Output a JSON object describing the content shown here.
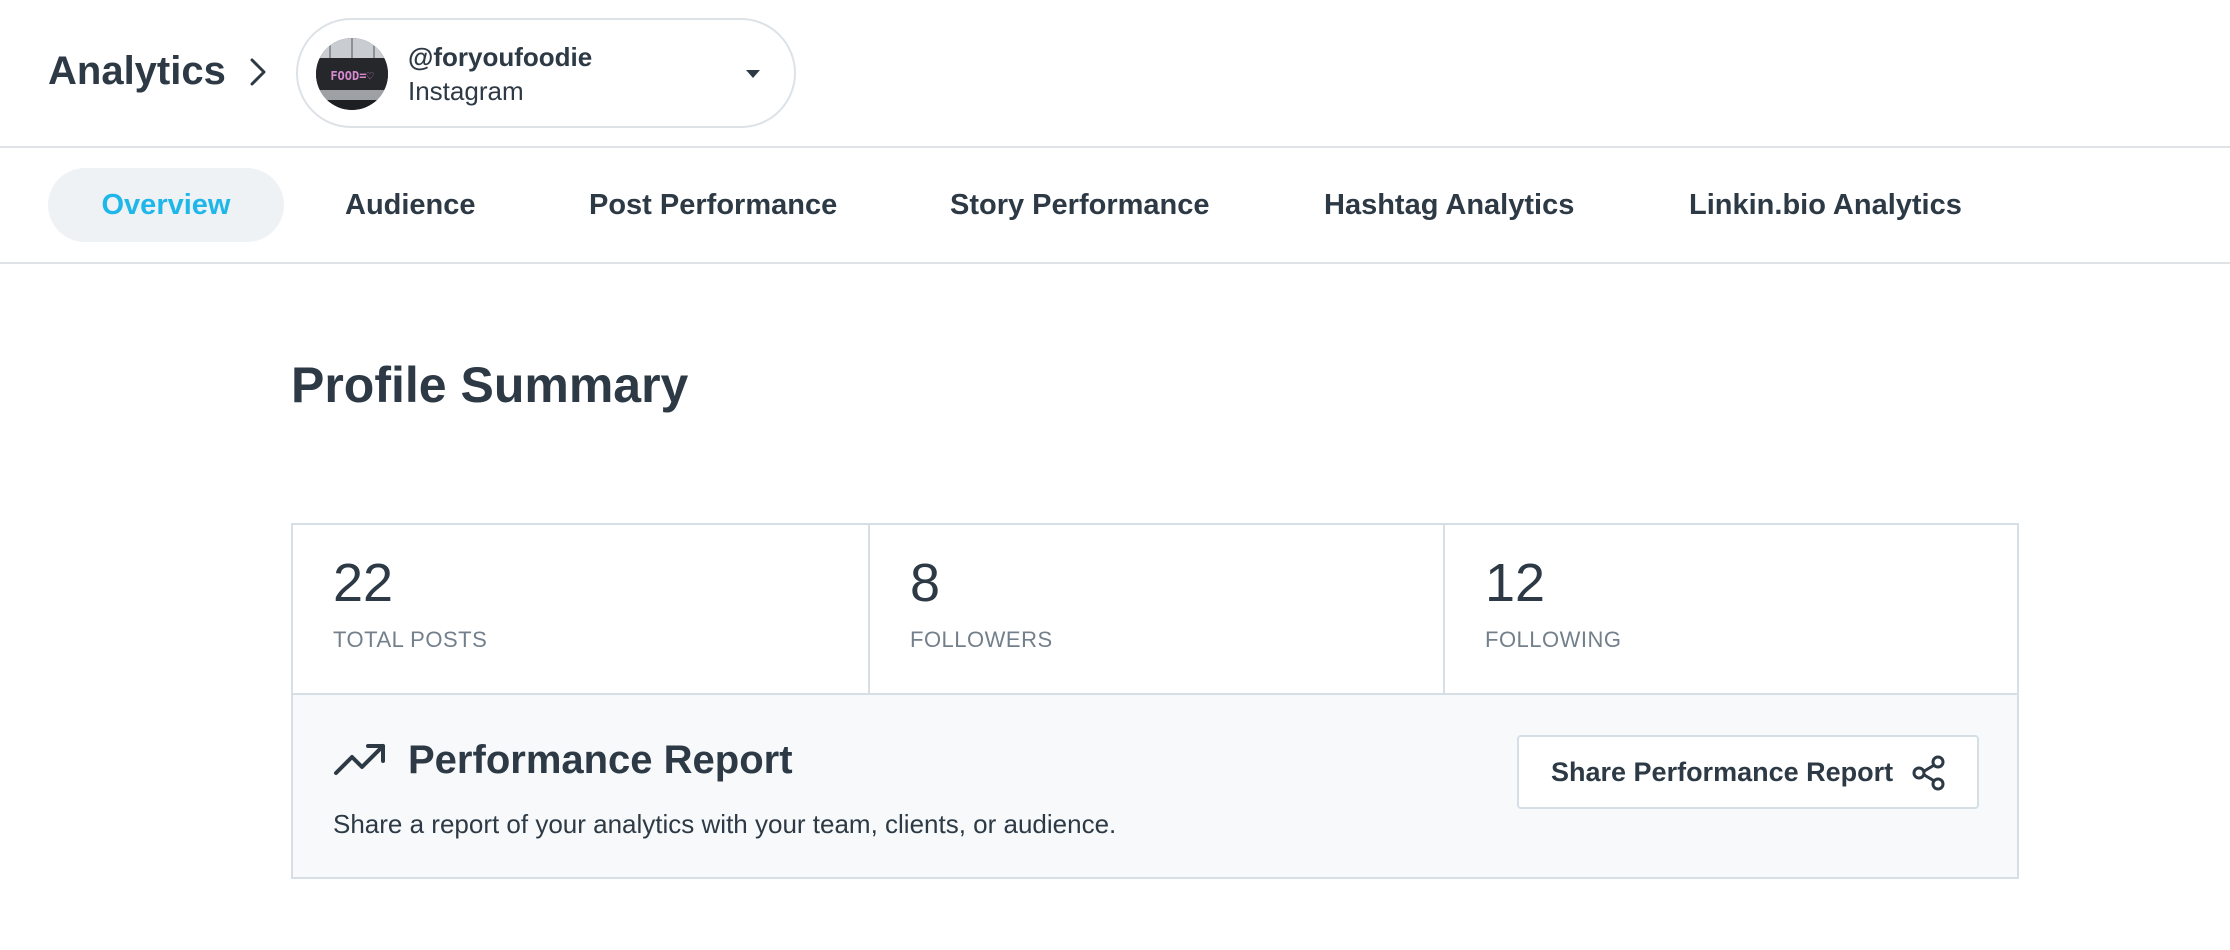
{
  "header": {
    "title": "Analytics",
    "chevron_icon": "chevron-right-icon",
    "account": {
      "handle": "@foryoufoodie",
      "network": "Instagram",
      "avatar_text": "FOOD=♡",
      "dropdown_icon": "caret-down-icon"
    }
  },
  "tabs": [
    {
      "label": "Overview",
      "active": true
    },
    {
      "label": "Audience",
      "active": false
    },
    {
      "label": "Post Performance",
      "active": false
    },
    {
      "label": "Story Performance",
      "active": false
    },
    {
      "label": "Hashtag Analytics",
      "active": false
    },
    {
      "label": "Linkin.bio Analytics",
      "active": false
    }
  ],
  "main": {
    "title": "Profile Summary",
    "stats": [
      {
        "value": "22",
        "label": "TOTAL POSTS"
      },
      {
        "value": "8",
        "label": "FOLLOWERS"
      },
      {
        "value": "12",
        "label": "FOLLOWING"
      }
    ],
    "report": {
      "icon": "trending-up-icon",
      "title": "Performance Report",
      "description": "Share a report of your analytics with your team, clients, or audience.",
      "share_label": "Share Performance Report",
      "share_icon": "share-icon"
    }
  },
  "colors": {
    "text": "#2d3a45",
    "muted": "#73808c",
    "accent": "#1fb6ea",
    "border": "#d6dee6",
    "panel_bg": "#f7f9fb",
    "tab_active_bg": "#eef2f5"
  }
}
